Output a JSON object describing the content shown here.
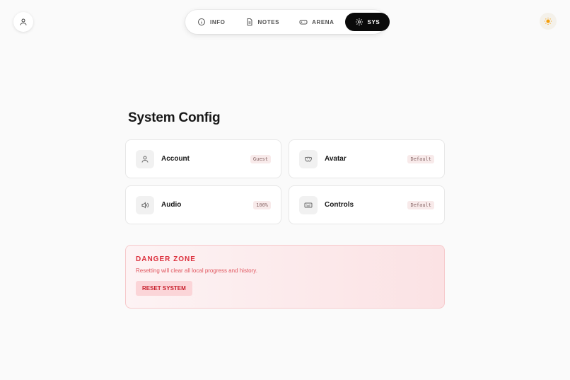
{
  "nav": {
    "tabs": [
      {
        "label": "INFO",
        "icon": "info-icon"
      },
      {
        "label": "NOTES",
        "icon": "document-icon"
      },
      {
        "label": "ARENA",
        "icon": "gamepad-icon"
      },
      {
        "label": "SYS",
        "icon": "gear-icon",
        "active": true
      }
    ]
  },
  "header": {
    "profile_icon": "user-icon",
    "theme_icon": "sun-icon"
  },
  "main": {
    "title": "System Config",
    "cards": [
      {
        "label": "Account",
        "badge": "Guest",
        "icon": "user-icon"
      },
      {
        "label": "Avatar",
        "badge": "Default",
        "icon": "mask-icon"
      },
      {
        "label": "Audio",
        "badge": "100%",
        "icon": "speaker-icon"
      },
      {
        "label": "Controls",
        "badge": "Default",
        "icon": "keyboard-icon"
      }
    ],
    "danger": {
      "title": "DANGER ZONE",
      "text": "Resetting will clear all local progress and history.",
      "button": "RESET SYSTEM"
    }
  },
  "colors": {
    "accent": "#0a0a0a",
    "danger": "#dc2f3c",
    "sun": "#f59e0b"
  }
}
